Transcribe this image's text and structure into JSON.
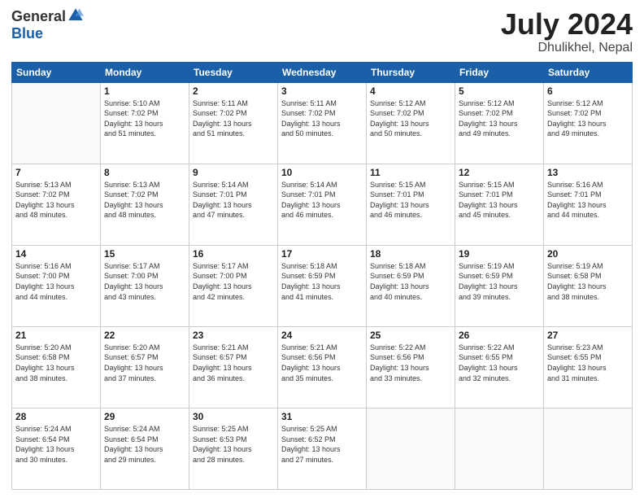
{
  "header": {
    "logo_general": "General",
    "logo_blue": "Blue",
    "month_title": "July 2024",
    "subtitle": "Dhulikhel, Nepal"
  },
  "calendar": {
    "days_of_week": [
      "Sunday",
      "Monday",
      "Tuesday",
      "Wednesday",
      "Thursday",
      "Friday",
      "Saturday"
    ],
    "weeks": [
      [
        {
          "day": "",
          "info": ""
        },
        {
          "day": "1",
          "info": "Sunrise: 5:10 AM\nSunset: 7:02 PM\nDaylight: 13 hours\nand 51 minutes."
        },
        {
          "day": "2",
          "info": "Sunrise: 5:11 AM\nSunset: 7:02 PM\nDaylight: 13 hours\nand 51 minutes."
        },
        {
          "day": "3",
          "info": "Sunrise: 5:11 AM\nSunset: 7:02 PM\nDaylight: 13 hours\nand 50 minutes."
        },
        {
          "day": "4",
          "info": "Sunrise: 5:12 AM\nSunset: 7:02 PM\nDaylight: 13 hours\nand 50 minutes."
        },
        {
          "day": "5",
          "info": "Sunrise: 5:12 AM\nSunset: 7:02 PM\nDaylight: 13 hours\nand 49 minutes."
        },
        {
          "day": "6",
          "info": "Sunrise: 5:12 AM\nSunset: 7:02 PM\nDaylight: 13 hours\nand 49 minutes."
        }
      ],
      [
        {
          "day": "7",
          "info": "Sunrise: 5:13 AM\nSunset: 7:02 PM\nDaylight: 13 hours\nand 48 minutes."
        },
        {
          "day": "8",
          "info": "Sunrise: 5:13 AM\nSunset: 7:02 PM\nDaylight: 13 hours\nand 48 minutes."
        },
        {
          "day": "9",
          "info": "Sunrise: 5:14 AM\nSunset: 7:01 PM\nDaylight: 13 hours\nand 47 minutes."
        },
        {
          "day": "10",
          "info": "Sunrise: 5:14 AM\nSunset: 7:01 PM\nDaylight: 13 hours\nand 46 minutes."
        },
        {
          "day": "11",
          "info": "Sunrise: 5:15 AM\nSunset: 7:01 PM\nDaylight: 13 hours\nand 46 minutes."
        },
        {
          "day": "12",
          "info": "Sunrise: 5:15 AM\nSunset: 7:01 PM\nDaylight: 13 hours\nand 45 minutes."
        },
        {
          "day": "13",
          "info": "Sunrise: 5:16 AM\nSunset: 7:01 PM\nDaylight: 13 hours\nand 44 minutes."
        }
      ],
      [
        {
          "day": "14",
          "info": "Sunrise: 5:16 AM\nSunset: 7:00 PM\nDaylight: 13 hours\nand 44 minutes."
        },
        {
          "day": "15",
          "info": "Sunrise: 5:17 AM\nSunset: 7:00 PM\nDaylight: 13 hours\nand 43 minutes."
        },
        {
          "day": "16",
          "info": "Sunrise: 5:17 AM\nSunset: 7:00 PM\nDaylight: 13 hours\nand 42 minutes."
        },
        {
          "day": "17",
          "info": "Sunrise: 5:18 AM\nSunset: 6:59 PM\nDaylight: 13 hours\nand 41 minutes."
        },
        {
          "day": "18",
          "info": "Sunrise: 5:18 AM\nSunset: 6:59 PM\nDaylight: 13 hours\nand 40 minutes."
        },
        {
          "day": "19",
          "info": "Sunrise: 5:19 AM\nSunset: 6:59 PM\nDaylight: 13 hours\nand 39 minutes."
        },
        {
          "day": "20",
          "info": "Sunrise: 5:19 AM\nSunset: 6:58 PM\nDaylight: 13 hours\nand 38 minutes."
        }
      ],
      [
        {
          "day": "21",
          "info": "Sunrise: 5:20 AM\nSunset: 6:58 PM\nDaylight: 13 hours\nand 38 minutes."
        },
        {
          "day": "22",
          "info": "Sunrise: 5:20 AM\nSunset: 6:57 PM\nDaylight: 13 hours\nand 37 minutes."
        },
        {
          "day": "23",
          "info": "Sunrise: 5:21 AM\nSunset: 6:57 PM\nDaylight: 13 hours\nand 36 minutes."
        },
        {
          "day": "24",
          "info": "Sunrise: 5:21 AM\nSunset: 6:56 PM\nDaylight: 13 hours\nand 35 minutes."
        },
        {
          "day": "25",
          "info": "Sunrise: 5:22 AM\nSunset: 6:56 PM\nDaylight: 13 hours\nand 33 minutes."
        },
        {
          "day": "26",
          "info": "Sunrise: 5:22 AM\nSunset: 6:55 PM\nDaylight: 13 hours\nand 32 minutes."
        },
        {
          "day": "27",
          "info": "Sunrise: 5:23 AM\nSunset: 6:55 PM\nDaylight: 13 hours\nand 31 minutes."
        }
      ],
      [
        {
          "day": "28",
          "info": "Sunrise: 5:24 AM\nSunset: 6:54 PM\nDaylight: 13 hours\nand 30 minutes."
        },
        {
          "day": "29",
          "info": "Sunrise: 5:24 AM\nSunset: 6:54 PM\nDaylight: 13 hours\nand 29 minutes."
        },
        {
          "day": "30",
          "info": "Sunrise: 5:25 AM\nSunset: 6:53 PM\nDaylight: 13 hours\nand 28 minutes."
        },
        {
          "day": "31",
          "info": "Sunrise: 5:25 AM\nSunset: 6:52 PM\nDaylight: 13 hours\nand 27 minutes."
        },
        {
          "day": "",
          "info": ""
        },
        {
          "day": "",
          "info": ""
        },
        {
          "day": "",
          "info": ""
        }
      ]
    ]
  }
}
